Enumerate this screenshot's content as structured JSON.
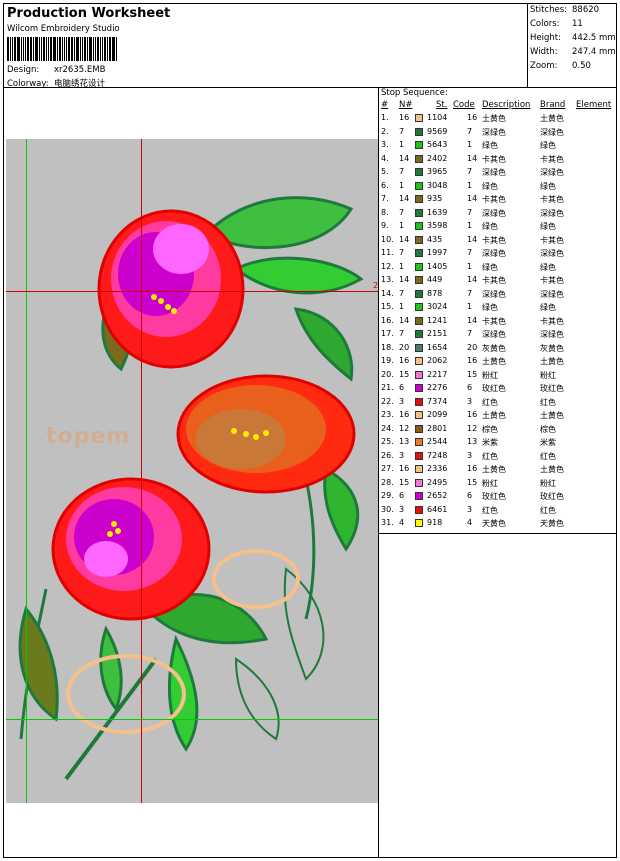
{
  "header": {
    "title": "Production Worksheet",
    "company": "Wilcom Embroidery Studio",
    "design_label": "Design:",
    "design_value": "xr2635.EMB",
    "colorway_label": "Colorway:",
    "colorway_value": "电脑绣花设计"
  },
  "stats": [
    {
      "label": "Stitches:",
      "value": "88620"
    },
    {
      "label": "Colors:",
      "value": "11"
    },
    {
      "label": "Height:",
      "value": "442.5 mm"
    },
    {
      "label": "Width:",
      "value": "247.4 mm"
    },
    {
      "label": "Zoom:",
      "value": "0.50"
    }
  ],
  "canvas": {
    "background": "#c0c0c0",
    "watermark": "topem",
    "edge_mark": "2"
  },
  "sequence": {
    "title": "Stop Sequence:",
    "headers": {
      "num": "#",
      "n": "N#",
      "st": "St.",
      "code": "Code",
      "desc": "Description",
      "brand": "Brand",
      "element": "Element"
    },
    "rows": [
      {
        "num": "1.",
        "n": "16",
        "color": "#f6c08a",
        "st": "1104",
        "code": "16",
        "desc": "土黄色",
        "brand": "土黄色"
      },
      {
        "num": "2.",
        "n": "7",
        "color": "#1e7a3c",
        "st": "9569",
        "code": "7",
        "desc": "深绿色",
        "brand": "深绿色"
      },
      {
        "num": "3.",
        "n": "1",
        "color": "#1fc31f",
        "st": "5643",
        "code": "1",
        "desc": "绿色",
        "brand": "绿色"
      },
      {
        "num": "4.",
        "n": "14",
        "color": "#7a6a1c",
        "st": "2402",
        "code": "14",
        "desc": "卡其色",
        "brand": "卡其色"
      },
      {
        "num": "5.",
        "n": "7",
        "color": "#1e7a3c",
        "st": "3965",
        "code": "7",
        "desc": "深绿色",
        "brand": "深绿色"
      },
      {
        "num": "6.",
        "n": "1",
        "color": "#1fc31f",
        "st": "3048",
        "code": "1",
        "desc": "绿色",
        "brand": "绿色"
      },
      {
        "num": "7.",
        "n": "14",
        "color": "#7a6a1c",
        "st": "935",
        "code": "14",
        "desc": "卡其色",
        "brand": "卡其色"
      },
      {
        "num": "8.",
        "n": "7",
        "color": "#1e7a3c",
        "st": "1639",
        "code": "7",
        "desc": "深绿色",
        "brand": "深绿色"
      },
      {
        "num": "9.",
        "n": "1",
        "color": "#1fc31f",
        "st": "3598",
        "code": "1",
        "desc": "绿色",
        "brand": "绿色"
      },
      {
        "num": "10.",
        "n": "14",
        "color": "#7a6a1c",
        "st": "435",
        "code": "14",
        "desc": "卡其色",
        "brand": "卡其色"
      },
      {
        "num": "11.",
        "n": "7",
        "color": "#1e7a3c",
        "st": "1997",
        "code": "7",
        "desc": "深绿色",
        "brand": "深绿色"
      },
      {
        "num": "12.",
        "n": "1",
        "color": "#1fc31f",
        "st": "1405",
        "code": "1",
        "desc": "绿色",
        "brand": "绿色"
      },
      {
        "num": "13.",
        "n": "14",
        "color": "#7a6a1c",
        "st": "449",
        "code": "14",
        "desc": "卡其色",
        "brand": "卡其色"
      },
      {
        "num": "14.",
        "n": "7",
        "color": "#1e7a3c",
        "st": "878",
        "code": "7",
        "desc": "深绿色",
        "brand": "深绿色"
      },
      {
        "num": "15.",
        "n": "1",
        "color": "#1fc31f",
        "st": "3024",
        "code": "1",
        "desc": "绿色",
        "brand": "绿色"
      },
      {
        "num": "16.",
        "n": "14",
        "color": "#7a6a1c",
        "st": "1241",
        "code": "14",
        "desc": "卡其色",
        "brand": "卡其色"
      },
      {
        "num": "17.",
        "n": "7",
        "color": "#1e7a3c",
        "st": "2151",
        "code": "7",
        "desc": "深绿色",
        "brand": "深绿色"
      },
      {
        "num": "18.",
        "n": "20",
        "color": "#4a7a68",
        "st": "1654",
        "code": "20",
        "desc": "灰黄色",
        "brand": "灰黄色"
      },
      {
        "num": "19.",
        "n": "16",
        "color": "#f6c08a",
        "st": "2062",
        "code": "16",
        "desc": "土黄色",
        "brand": "土黄色"
      },
      {
        "num": "20.",
        "n": "15",
        "color": "#f07ad0",
        "st": "2217",
        "code": "15",
        "desc": "粉红",
        "brand": "粉红"
      },
      {
        "num": "21.",
        "n": "6",
        "color": "#d000d0",
        "st": "2276",
        "code": "6",
        "desc": "玫红色",
        "brand": "玫红色"
      },
      {
        "num": "22.",
        "n": "3",
        "color": "#e01010",
        "st": "7374",
        "code": "3",
        "desc": "红色",
        "brand": "红色"
      },
      {
        "num": "23.",
        "n": "16",
        "color": "#f6c08a",
        "st": "2099",
        "code": "16",
        "desc": "土黄色",
        "brand": "土黄色"
      },
      {
        "num": "24.",
        "n": "12",
        "color": "#8a5a1c",
        "st": "2801",
        "code": "12",
        "desc": "棕色",
        "brand": "棕色"
      },
      {
        "num": "25.",
        "n": "13",
        "color": "#f07820",
        "st": "2544",
        "code": "13",
        "desc": "米紫",
        "brand": "米紫"
      },
      {
        "num": "26.",
        "n": "3",
        "color": "#e01010",
        "st": "7248",
        "code": "3",
        "desc": "红色",
        "brand": "红色"
      },
      {
        "num": "27.",
        "n": "16",
        "color": "#f6c08a",
        "st": "2336",
        "code": "16",
        "desc": "土黄色",
        "brand": "土黄色"
      },
      {
        "num": "28.",
        "n": "15",
        "color": "#f07ad0",
        "st": "2495",
        "code": "15",
        "desc": "粉红",
        "brand": "粉红"
      },
      {
        "num": "29.",
        "n": "6",
        "color": "#d000d0",
        "st": "2652",
        "code": "6",
        "desc": "玫红色",
        "brand": "玫红色"
      },
      {
        "num": "30.",
        "n": "3",
        "color": "#e01010",
        "st": "6461",
        "code": "3",
        "desc": "红色",
        "brand": "红色"
      },
      {
        "num": "31.",
        "n": "4",
        "color": "#ffff00",
        "st": "918",
        "code": "4",
        "desc": "天黄色",
        "brand": "天黄色"
      }
    ]
  }
}
